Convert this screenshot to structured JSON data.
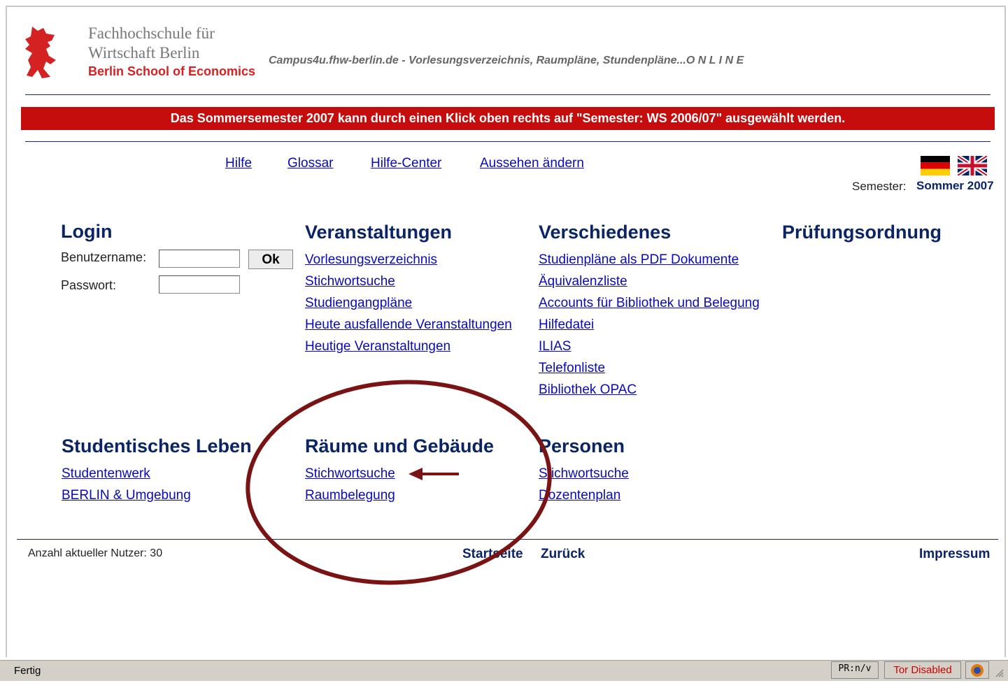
{
  "header": {
    "institution_line1": "Fachhochschule für",
    "institution_line2": "Wirtschaft Berlin",
    "institution_line3": "Berlin School of Economics",
    "tagline": "Campus4u.fhw-berlin.de - Vorlesungsverzeichnis, Raumpläne, Stundenpläne...O N L I N E"
  },
  "banner": "Das Sommersemester 2007 kann durch einen Klick oben rechts auf \"Semester: WS 2006/07\" ausgewählt werden.",
  "nav": {
    "hilfe": "Hilfe",
    "glossar": "Glossar",
    "hilfe_center": "Hilfe-Center",
    "aussehen": "Aussehen ändern"
  },
  "semester": {
    "label": "Semester:",
    "value": "Sommer 2007"
  },
  "login": {
    "title": "Login",
    "username_label": "Benutzername:",
    "password_label": "Passwort:",
    "ok_label": "Ok",
    "username_value": "",
    "password_value": ""
  },
  "veranstaltungen": {
    "title": "Veranstaltungen",
    "items": [
      "Vorlesungsverzeichnis",
      "Stichwortsuche",
      "Studiengangpläne",
      "Heute ausfallende Veranstaltungen",
      "Heutige Veranstaltungen"
    ]
  },
  "verschiedenes": {
    "title": "Verschiedenes",
    "items": [
      "Studienpläne als PDF Dokumente",
      "Äquivalenzliste",
      "Accounts für Bibliothek und Belegung",
      "Hilfedatei",
      "ILIAS",
      "Telefonliste",
      "Bibliothek OPAC"
    ]
  },
  "pruefungsordnung": {
    "title": "Prüfungsordnung"
  },
  "studentisches_leben": {
    "title": "Studentisches Leben",
    "items": [
      "Studentenwerk",
      "BERLIN & Umgebung"
    ]
  },
  "raeume": {
    "title": "Räume und Gebäude",
    "items": [
      "Stichwortsuche",
      "Raumbelegung"
    ]
  },
  "personen": {
    "title": "Personen",
    "items": [
      "Stichwortsuche",
      "Dozentenplan"
    ]
  },
  "footer": {
    "users": "Anzahl aktueller Nutzer: 30",
    "startseite": "Startseite",
    "zurueck": "Zurück",
    "impressum": "Impressum"
  },
  "statusbar": {
    "status": "Fertig",
    "pr": "PR:n/v",
    "tor": "Tor Disabled"
  },
  "colors": {
    "banner_red": "#c50d0d",
    "heading_navy": "#0a2466",
    "link_blue": "#0a0ab8",
    "annotation_maroon": "#7a1414"
  }
}
